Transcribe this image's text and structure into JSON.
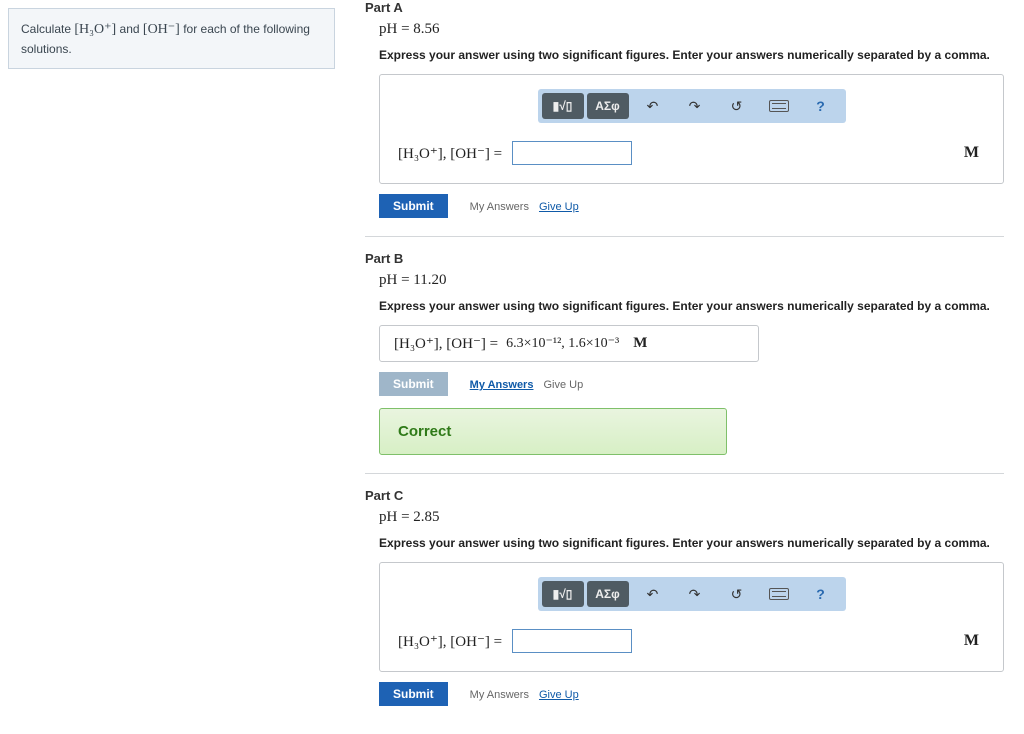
{
  "sidebar": {
    "prompt_pre": "Calculate ",
    "h3o": "[H₃O⁺]",
    "mid": " and ",
    "oh": "[OH⁻]",
    "prompt_post": " for each of the following solutions."
  },
  "toolbar": {
    "tpl": "▮√▯",
    "greek": "ΑΣφ",
    "undo": "↶",
    "redo": "↷",
    "reset": "↺",
    "help": "?"
  },
  "common": {
    "instr": "Express your answer using two significant figures. Enter your answers numerically separated by a comma.",
    "expr": "[H₃O⁺], [OH⁻] =",
    "unit": "M",
    "submit": "Submit",
    "my_answers": "My Answers",
    "give_up": "Give Up"
  },
  "partA": {
    "title": "Part A",
    "ph_label": "pH = 8.56"
  },
  "partB": {
    "title": "Part B",
    "ph_label": "pH = 11.20",
    "value": "6.3×10⁻¹², 1.6×10⁻³",
    "correct": "Correct"
  },
  "partC": {
    "title": "Part C",
    "ph_label": "pH = 2.85"
  }
}
